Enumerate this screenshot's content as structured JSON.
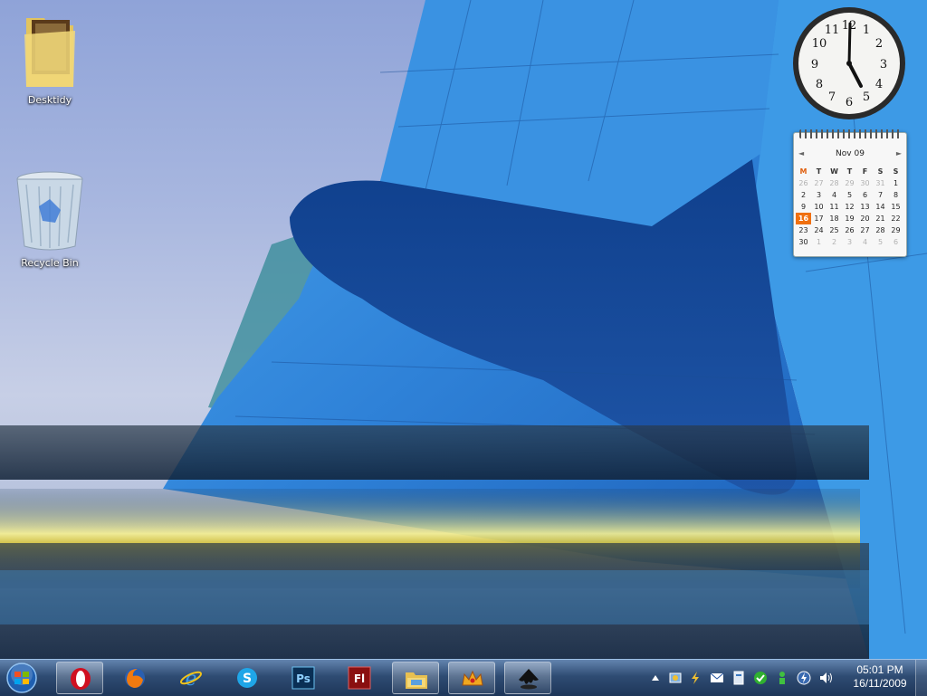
{
  "desktop": {
    "icons": [
      {
        "label": "Desktidy",
        "icon": "folder-icon"
      },
      {
        "label": "Recycle Bin",
        "icon": "recycle-bin-icon"
      }
    ]
  },
  "gadgets": {
    "clock": {
      "time": "05:01",
      "numerals": [
        "12",
        "1",
        "2",
        "3",
        "4",
        "5",
        "6",
        "7",
        "8",
        "9",
        "10",
        "11"
      ]
    },
    "calendar": {
      "month_label": "Nov 09",
      "prev": "◄",
      "next": "►",
      "weekdays": [
        "M",
        "T",
        "W",
        "T",
        "F",
        "S",
        "S"
      ],
      "weeks": [
        [
          "26",
          "27",
          "28",
          "29",
          "30",
          "31",
          "1"
        ],
        [
          "2",
          "3",
          "4",
          "5",
          "6",
          "7",
          "8"
        ],
        [
          "9",
          "10",
          "11",
          "12",
          "13",
          "14",
          "15"
        ],
        [
          "16",
          "17",
          "18",
          "19",
          "20",
          "21",
          "22"
        ],
        [
          "23",
          "24",
          "25",
          "26",
          "27",
          "28",
          "29"
        ],
        [
          "30",
          "1",
          "2",
          "3",
          "4",
          "5",
          "6"
        ]
      ],
      "today": "16"
    }
  },
  "taskbar": {
    "start": {
      "icon": "windows-start-orb-icon"
    },
    "pinned": [
      {
        "name": "opera",
        "icon": "opera-icon",
        "active": true
      },
      {
        "name": "firefox",
        "icon": "firefox-icon",
        "active": false
      },
      {
        "name": "internet-explorer",
        "icon": "internet-explorer-icon",
        "active": false
      },
      {
        "name": "skype",
        "icon": "skype-icon",
        "active": false
      },
      {
        "name": "photoshop",
        "icon": "photoshop-icon",
        "active": false,
        "label": "Ps"
      },
      {
        "name": "flash",
        "icon": "flash-icon",
        "active": false,
        "label": "Fl"
      },
      {
        "name": "windows-explorer",
        "icon": "windows-explorer-icon",
        "active": true
      },
      {
        "name": "app-crown",
        "icon": "crown-app-icon",
        "active": true
      },
      {
        "name": "inkscape",
        "icon": "inkscape-icon",
        "active": true
      }
    ],
    "tray": {
      "icons": [
        "show-hidden-icons-arrow-icon",
        "network-app-icon",
        "lightning-app-icon",
        "mail-icon",
        "document-app-icon",
        "chat-app-icon",
        "user-app-icon",
        "power-icon",
        "volume-icon"
      ]
    },
    "clock": {
      "time": "05:01 PM",
      "date": "16/11/2009"
    }
  },
  "colors": {
    "taskbar": "#2a4a78",
    "calendar_today": "#f07010",
    "wallpaper_blue": "#2f82d8",
    "sky": "#9fb0dc"
  }
}
